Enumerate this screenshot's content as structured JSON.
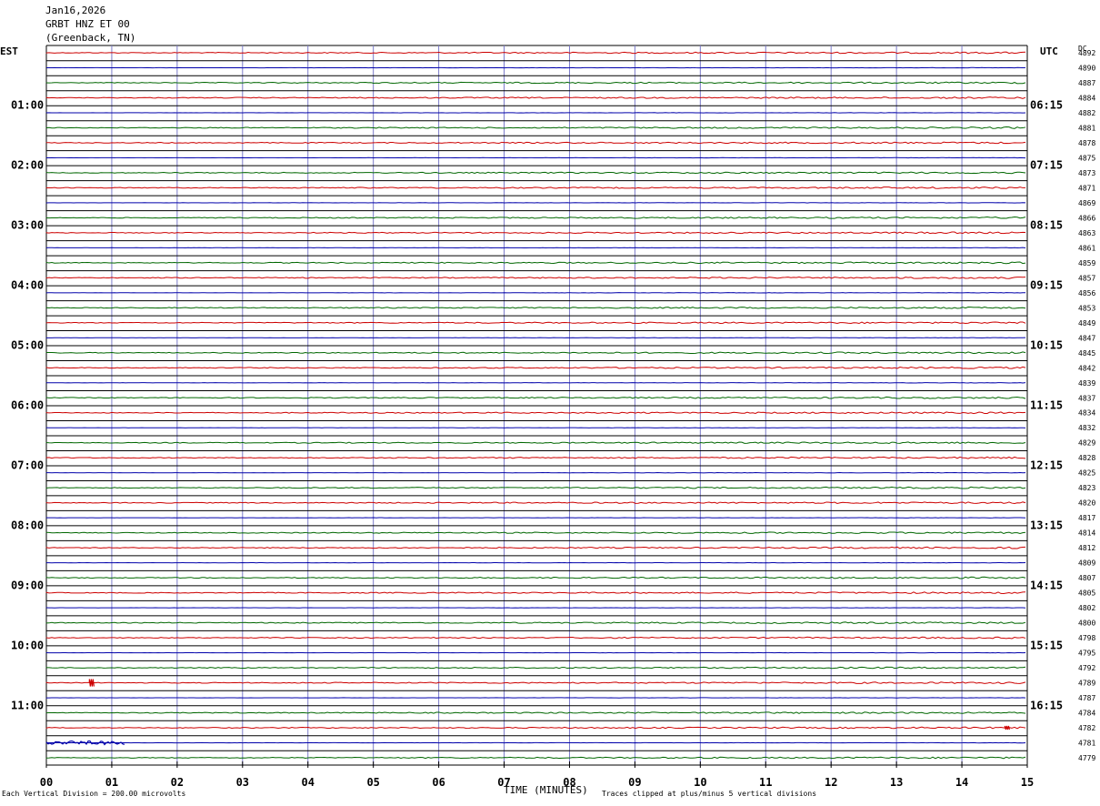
{
  "header": {
    "date": "Jan16,2026",
    "station": "GRBT HNZ ET 00",
    "location": "(Greenback, TN)"
  },
  "left_zone_label": "EST",
  "right_zone_label": "UTC",
  "dc_label": "DC",
  "footer": {
    "scale_note": "Each Vertical Division =  200.00 microvolts",
    "clip_note": "Traces clipped at plus/minus 5 vertical divisions",
    "xlabel": "TIME (MINUTES)"
  },
  "colors": {
    "grid_vertical": "#7a7ac8",
    "row_line": "#000000",
    "trace_cycle": [
      "#cc0000",
      "#0000aa",
      "#006600"
    ]
  },
  "chart_data": {
    "type": "line",
    "title": "GRBT HNZ ET 00 (Greenback, TN) Jan16,2026",
    "xlabel": "TIME (MINUTES)",
    "ylabel": "",
    "xlim": [
      0,
      15
    ],
    "x_ticks": [
      "00",
      "01",
      "02",
      "03",
      "04",
      "05",
      "06",
      "07",
      "08",
      "09",
      "10",
      "11",
      "12",
      "13",
      "14",
      "15"
    ],
    "rows": 48,
    "minutes_per_row": 15,
    "left_hour_labels": [
      "01:00",
      "02:00",
      "03:00",
      "04:00",
      "05:00",
      "06:00",
      "07:00",
      "08:00",
      "09:00",
      "10:00",
      "11:00"
    ],
    "right_hour_labels": [
      "06:15",
      "07:15",
      "08:15",
      "09:15",
      "10:15",
      "11:15",
      "12:15",
      "13:15",
      "14:15",
      "15:15",
      "16:15"
    ],
    "dc_offsets": [
      "4892",
      "4890",
      "4887",
      "4884",
      "4882",
      "4881",
      "4878",
      "4875",
      "4873",
      "4871",
      "4869",
      "4866",
      "4863",
      "4861",
      "4859",
      "4857",
      "4856",
      "4853",
      "4849",
      "4847",
      "4845",
      "4842",
      "4839",
      "4837",
      "4834",
      "4832",
      "4829",
      "4828",
      "4825",
      "4823",
      "4820",
      "4817",
      "4814",
      "4812",
      "4809",
      "4807",
      "4805",
      "4802",
      "4800",
      "4798",
      "4795",
      "4792",
      "4789",
      "4787",
      "4784",
      "4782",
      "4781",
      "4779"
    ],
    "events": [
      {
        "row": 42,
        "minute": 0.7,
        "amplitude": 4
      },
      {
        "row": 45,
        "minute": 14.7,
        "amplitude": 2
      },
      {
        "row": 46,
        "minute": 0.0,
        "minute_end": 1.2,
        "amplitude": 2
      }
    ],
    "grid": true
  }
}
